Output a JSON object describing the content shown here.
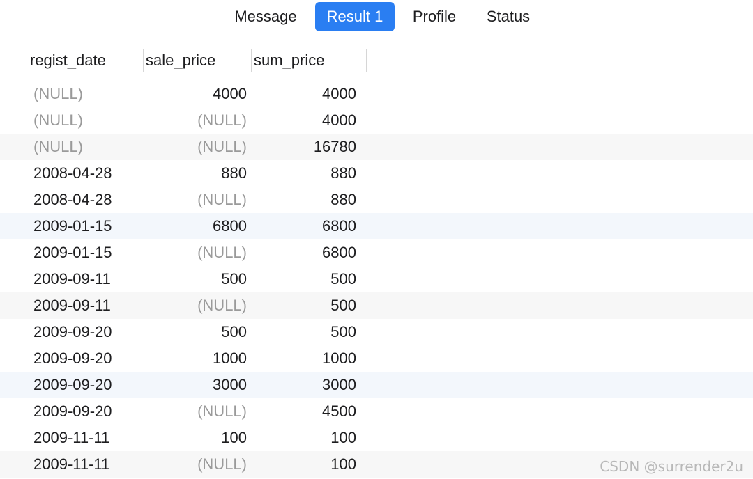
{
  "tabs": [
    {
      "label": "Message",
      "active": false
    },
    {
      "label": "Result 1",
      "active": true
    },
    {
      "label": "Profile",
      "active": false
    },
    {
      "label": "Status",
      "active": false
    }
  ],
  "accent_color": "#2a7ef2",
  "columns": [
    "regist_date",
    "sale_price",
    "sum_price"
  ],
  "rows": [
    [
      "(NULL)",
      "4000",
      "4000"
    ],
    [
      "(NULL)",
      "(NULL)",
      "4000"
    ],
    [
      "(NULL)",
      "(NULL)",
      "16780"
    ],
    [
      "2008-04-28",
      "880",
      "880"
    ],
    [
      "2008-04-28",
      "(NULL)",
      "880"
    ],
    [
      "2009-01-15",
      "6800",
      "6800"
    ],
    [
      "2009-01-15",
      "(NULL)",
      "6800"
    ],
    [
      "2009-09-11",
      "500",
      "500"
    ],
    [
      "2009-09-11",
      "(NULL)",
      "500"
    ],
    [
      "2009-09-20",
      "500",
      "500"
    ],
    [
      "2009-09-20",
      "1000",
      "1000"
    ],
    [
      "2009-09-20",
      "3000",
      "3000"
    ],
    [
      "2009-09-20",
      "(NULL)",
      "4500"
    ],
    [
      "2009-11-11",
      "100",
      "100"
    ],
    [
      "2009-11-11",
      "(NULL)",
      "100"
    ]
  ],
  "watermark": "CSDN @surrender2u"
}
